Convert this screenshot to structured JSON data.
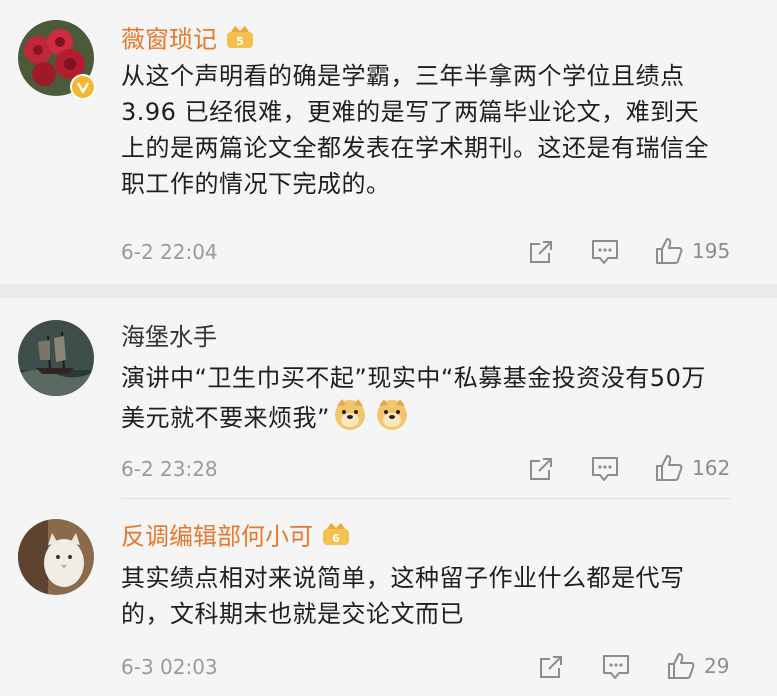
{
  "comments": [
    {
      "user": "薇窗琐记",
      "text": "从这个声明看的确是学霸，三年半拿两个学位且绩点 3.96 已经很难，更难的是写了两篇毕业论文，难到天上的是两篇论文全都发表在学术期刊。这还是有瑞信全职工作的情况下完成的。",
      "time": "6-2 22:04",
      "likes": "195",
      "name_color": "#e8782a"
    },
    {
      "user": "海堡水手",
      "text": "演讲中“卫生巾买不起”现实中“私募基金投资没有50万美元就不要来烦我”",
      "time": "6-2 23:28",
      "likes": "162",
      "name_color": "#333333"
    },
    {
      "user": "反调编辑部何小可",
      "text": "其实绩点相对来说简单，这种留子作业什么都是代写的，文科期末也就是交论文而已",
      "time": "6-3 02:03",
      "likes": "29",
      "name_color": "#e8782a"
    }
  ]
}
